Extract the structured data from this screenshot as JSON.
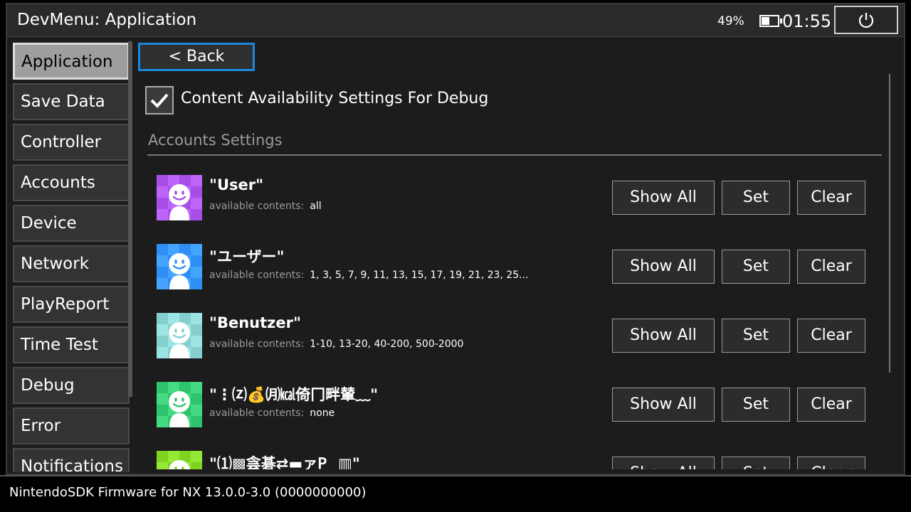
{
  "header": {
    "title": "DevMenu: Application",
    "battery_pct": "49%",
    "battery_level": 0.49,
    "clock": "01:55"
  },
  "sidebar": {
    "items": [
      {
        "label": "Application",
        "active": true
      },
      {
        "label": "Save Data"
      },
      {
        "label": "Controller"
      },
      {
        "label": "Accounts"
      },
      {
        "label": "Device"
      },
      {
        "label": "Network"
      },
      {
        "label": "PlayReport"
      },
      {
        "label": "Time Test"
      },
      {
        "label": "Debug"
      },
      {
        "label": "Error"
      },
      {
        "label": "Notifications"
      }
    ]
  },
  "main": {
    "back_label": "< Back",
    "checkbox_label": "Content Availability Settings For Debug",
    "checkbox_checked": true,
    "section_title": "Accounts Settings",
    "buttons": {
      "show_all": "Show All",
      "set": "Set",
      "clear": "Clear"
    },
    "available_label": "available contents:",
    "accounts": [
      {
        "name": "\"User\"",
        "contents": "all",
        "color": "#a64ee6"
      },
      {
        "name": "\"ユーザー\"",
        "contents": "1, 3, 5, 7, 9, 11, 13, 15, 17, 19, 21, 23, 25...",
        "color": "#2e8ef5"
      },
      {
        "name": "\"Benutzer\"",
        "contents": "1-10, 13-20, 40-200, 500-2000",
        "color": "#86cfcf"
      },
      {
        "name": "\"⋮⒵💰㈪㎉倚冂畔輦﹏\"",
        "contents": "none",
        "color": "#2ec46c"
      },
      {
        "name": "\"⑴▩侌碁⇄▬ァ𝖯▁▥\"",
        "contents": "",
        "color": "#7ed321"
      }
    ]
  },
  "footer": {
    "text": "NintendoSDK Firmware for NX 13.0.0-3.0 (0000000000)"
  }
}
